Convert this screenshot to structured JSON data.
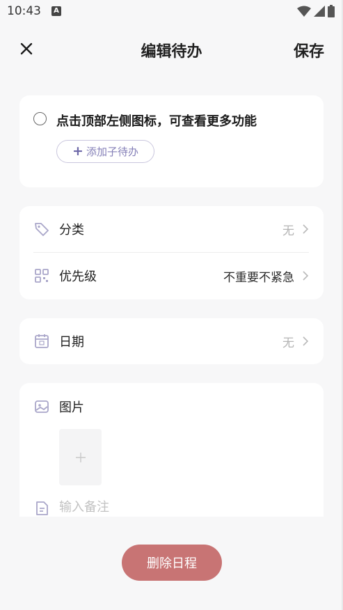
{
  "status_bar": {
    "time": "10:43",
    "badge": "A"
  },
  "header": {
    "title": "编辑待办",
    "save_label": "保存"
  },
  "todo": {
    "title": "点击顶部左侧图标，可查看更多功能",
    "add_subtask_label": "添加子待办"
  },
  "rows": {
    "category": {
      "label": "分类",
      "value": "无"
    },
    "priority": {
      "label": "优先级",
      "value": "不重要不紧急"
    },
    "date": {
      "label": "日期",
      "value": "无"
    }
  },
  "media": {
    "image_label": "图片",
    "note_placeholder": "输入备注"
  },
  "footer": {
    "delete_label": "删除日程"
  },
  "colors": {
    "accent": "#8580b8",
    "icon": "#a9a6c9",
    "delete": "#c87474"
  }
}
